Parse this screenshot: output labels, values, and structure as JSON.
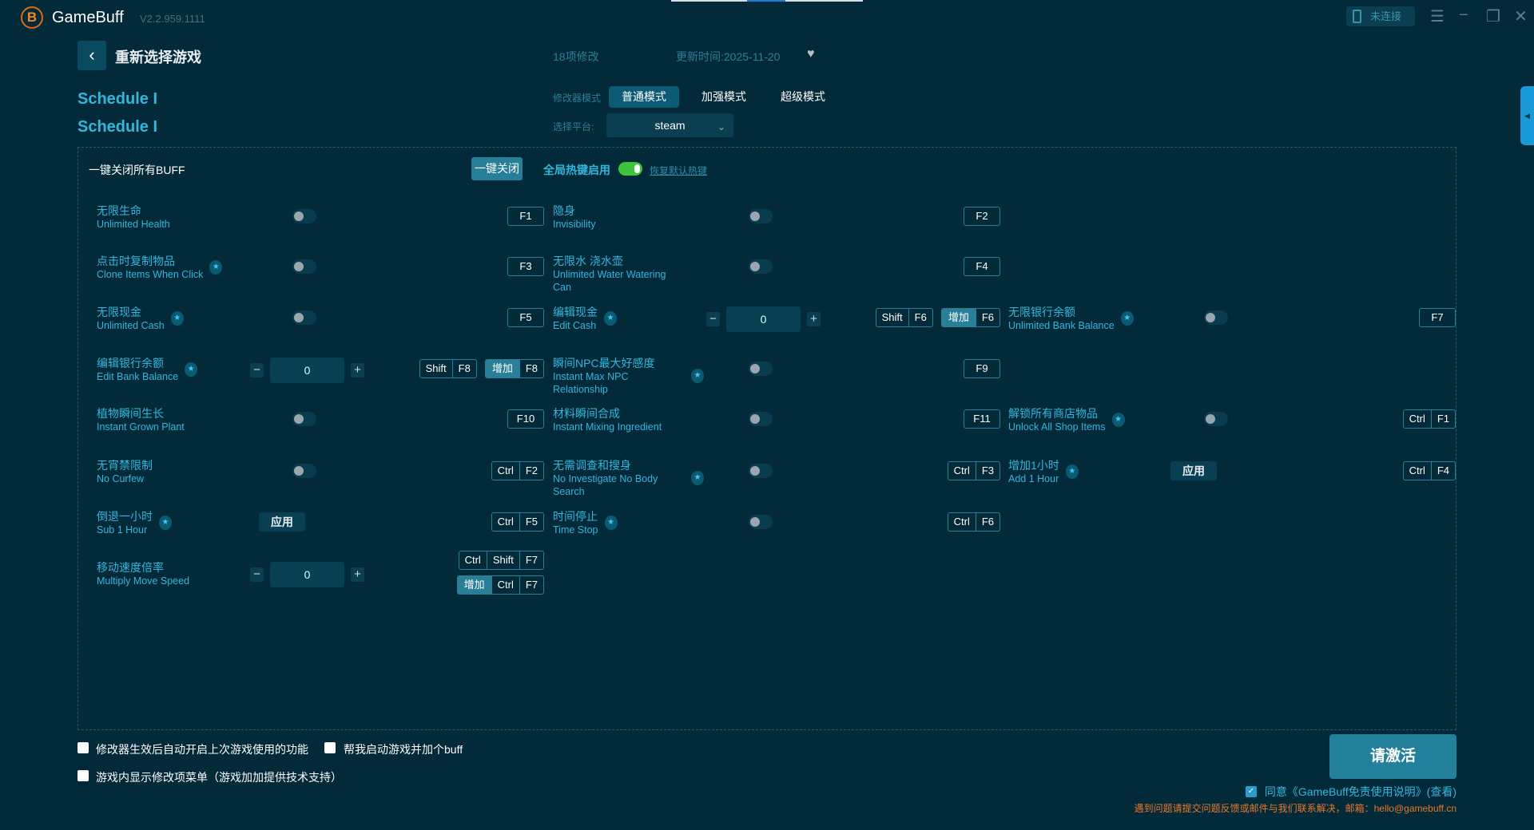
{
  "app": {
    "title": "GameBuff",
    "version": "V2.2.959.1111",
    "logo_letter": "B",
    "connection": "未连接"
  },
  "header": {
    "back_label": "重新选择游戏",
    "mod_count": "18项修改",
    "updated": "更新时间:2025-11-20",
    "game_title": "Schedule I",
    "game_subtitle": "Schedule I"
  },
  "mode": {
    "label": "修改器模式",
    "options": [
      "普通模式",
      "加强模式",
      "超级模式"
    ],
    "selected": "普通模式"
  },
  "platform": {
    "label": "选择平台:",
    "value": "steam"
  },
  "controls": {
    "close_all_label": "一键关闭所有BUFF",
    "close_all_button": "一键关闭",
    "hotkey_label": "全局热键启用",
    "hotkey_enabled": true,
    "restore_hotkeys": "恢复默认热键"
  },
  "columns": [
    [
      {
        "cn": "无限生命",
        "en": "Unlimited Health",
        "star": false,
        "control": "toggle",
        "keys": [
          [
            "F1"
          ]
        ]
      },
      {
        "cn": "点击时复制物品",
        "en": "Clone Items When Click",
        "star": true,
        "control": "toggle",
        "keys": [
          [
            "F3"
          ]
        ]
      },
      {
        "cn": "无限现金",
        "en": "Unlimited Cash",
        "star": true,
        "control": "toggle",
        "keys": [
          [
            "F5"
          ]
        ]
      },
      {
        "cn": "编辑银行余额",
        "en": "Edit Bank Balance",
        "star": true,
        "control": "stepper",
        "value": "0",
        "keys": [
          [
            "Shift",
            "F8"
          ],
          [
            "增加",
            "F8"
          ]
        ]
      },
      {
        "cn": "植物瞬间生长",
        "en": "Instant Grown Plant",
        "star": false,
        "control": "toggle",
        "keys": [
          [
            "F10"
          ]
        ]
      },
      {
        "cn": "无宵禁限制",
        "en": "No Curfew",
        "star": false,
        "control": "toggle",
        "keys": [
          [
            "Ctrl",
            "F2"
          ]
        ]
      },
      {
        "cn": "倒退一小时",
        "en": "Sub 1 Hour",
        "star": true,
        "control": "apply",
        "apply_label": "应用",
        "keys": [
          [
            "Ctrl",
            "F5"
          ]
        ]
      },
      {
        "cn": "移动速度倍率",
        "en": "Multiply Move Speed",
        "star": false,
        "control": "stepper",
        "value": "0",
        "keys": [
          [
            "Ctrl",
            "Shift",
            "F7"
          ],
          [
            "增加",
            "Ctrl",
            "F7"
          ]
        ],
        "stack": true
      }
    ],
    [
      {
        "cn": "隐身",
        "en": "Invisibility",
        "star": false,
        "control": "toggle",
        "keys": [
          [
            "F2"
          ]
        ]
      },
      {
        "cn": "无限水 浇水壶",
        "en": "Unlimited Water Watering Can",
        "star": false,
        "control": "toggle",
        "keys": [
          [
            "F4"
          ]
        ]
      },
      {
        "cn": "编辑现金",
        "en": "Edit Cash",
        "star": true,
        "control": "stepper",
        "value": "0",
        "keys": [
          [
            "Shift",
            "F6"
          ],
          [
            "增加",
            "F6"
          ]
        ]
      },
      {
        "cn": "瞬间NPC最大好感度",
        "en": "Instant Max NPC Relationship",
        "star": true,
        "control": "toggle",
        "keys": [
          [
            "F9"
          ]
        ]
      },
      {
        "cn": "材料瞬间合成",
        "en": "Instant Mixing Ingredient",
        "star": false,
        "control": "toggle",
        "keys": [
          [
            "F11"
          ]
        ]
      },
      {
        "cn": "无需调查和搜身",
        "en": "No Investigate No Body Search",
        "star": true,
        "control": "toggle",
        "keys": [
          [
            "Ctrl",
            "F3"
          ]
        ]
      },
      {
        "cn": "时间停止",
        "en": "Time Stop",
        "star": true,
        "control": "toggle",
        "keys": [
          [
            "Ctrl",
            "F6"
          ]
        ]
      }
    ],
    [
      null,
      null,
      {
        "cn": "无限银行余额",
        "en": "Unlimited Bank Balance",
        "star": true,
        "control": "toggle",
        "keys": [
          [
            "F7"
          ]
        ]
      },
      null,
      {
        "cn": "解锁所有商店物品",
        "en": "Unlock All Shop Items",
        "star": true,
        "control": "toggle",
        "keys": [
          [
            "Ctrl",
            "F1"
          ]
        ]
      },
      {
        "cn": "增加1小时",
        "en": "Add 1 Hour",
        "star": true,
        "control": "apply",
        "apply_label": "应用",
        "keys": [
          [
            "Ctrl",
            "F4"
          ]
        ]
      }
    ]
  ],
  "footer": {
    "options": [
      "修改器生效后自动开启上次游戏使用的功能",
      "帮我启动游戏并加个buff",
      "游戏内显示修改项菜单（游戏加加提供技术支持）"
    ],
    "activate": "请激活",
    "agreement": "同意《GameBuff免责使用说明》(查看)",
    "contact": "遇到问题请提交问题反馈或邮件与我们联系解决，邮箱：hello@gamebuff.cn"
  },
  "colors": {
    "background": "#032a38",
    "accent": "#34b6dc",
    "button": "#23809a",
    "toggle_on": "#3cc43c",
    "warning": "#e8782a"
  }
}
